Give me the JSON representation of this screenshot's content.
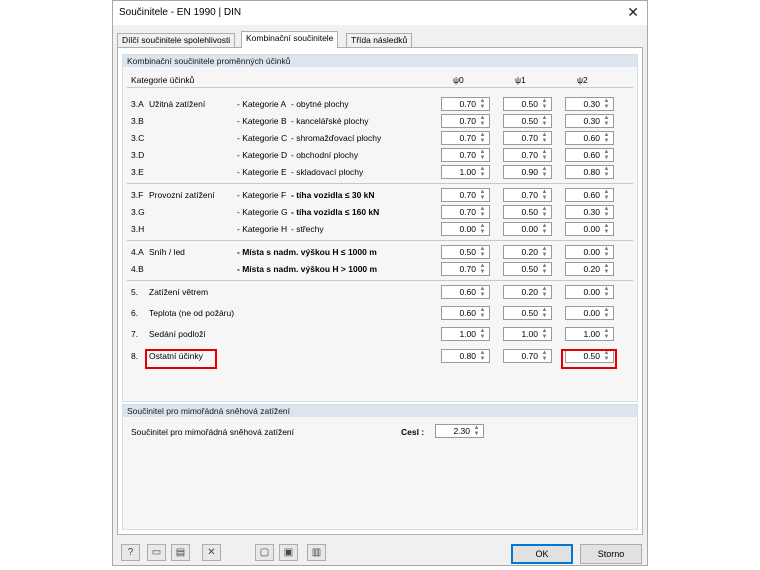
{
  "window": {
    "title": "Součinitele - EN 1990 | DIN",
    "close": "✕"
  },
  "tabs": [
    "Dílčí součinitele spolehlivosti",
    "Kombinační součinitele",
    "Třída následků"
  ],
  "group1": {
    "title": "Kombinační součinitele proměnných účinků",
    "category_header": "Kategorie účinků",
    "col_psi0": "ψ0",
    "col_psi1": "ψ1",
    "col_psi2": "ψ2",
    "rows": [
      {
        "num": "3.A",
        "name": "Užitná zatížení",
        "cat": "- Kategorie A",
        "desc": "- obytné plochy",
        "bold": false,
        "v0": "0.70",
        "v1": "0.50",
        "v2": "0.30"
      },
      {
        "num": "3.B",
        "name": "",
        "cat": "- Kategorie B",
        "desc": "- kancelářské plochy",
        "bold": false,
        "v0": "0.70",
        "v1": "0.50",
        "v2": "0.30"
      },
      {
        "num": "3.C",
        "name": "",
        "cat": "- Kategorie C",
        "desc": "- shromažďovací plochy",
        "bold": false,
        "v0": "0.70",
        "v1": "0.70",
        "v2": "0.60"
      },
      {
        "num": "3.D",
        "name": "",
        "cat": "- Kategorie D",
        "desc": "- obchodní plochy",
        "bold": false,
        "v0": "0.70",
        "v1": "0.70",
        "v2": "0.60"
      },
      {
        "num": "3.E",
        "name": "",
        "cat": "- Kategorie E",
        "desc": "- skladovací plochy",
        "bold": false,
        "v0": "1.00",
        "v1": "0.90",
        "v2": "0.80"
      },
      {
        "num": "3.F",
        "name": "Provozní zatížení",
        "cat": "- Kategorie F",
        "desc": "- tíha vozidla ≤ 30 kN",
        "bold": true,
        "v0": "0.70",
        "v1": "0.70",
        "v2": "0.60"
      },
      {
        "num": "3.G",
        "name": "",
        "cat": "- Kategorie G",
        "desc": "- tíha vozidla ≤ 160 kN",
        "bold": true,
        "v0": "0.70",
        "v1": "0.50",
        "v2": "0.30"
      },
      {
        "num": "3.H",
        "name": "",
        "cat": "- Kategorie H",
        "desc": "- střechy",
        "bold": false,
        "v0": "0.00",
        "v1": "0.00",
        "v2": "0.00"
      },
      {
        "num": "4.A",
        "name": "Sníh / led",
        "cat": "",
        "desc": "- Místa s nadm. výškou H ≤ 1000 m",
        "bold": true,
        "v0": "0.50",
        "v1": "0.20",
        "v2": "0.00"
      },
      {
        "num": "4.B",
        "name": "",
        "cat": "",
        "desc": "- Místa s nadm. výškou H > 1000 m",
        "bold": true,
        "v0": "0.70",
        "v1": "0.50",
        "v2": "0.20"
      },
      {
        "num": "5.",
        "name": "Zatížení větrem",
        "cat": "",
        "desc": "",
        "bold": false,
        "v0": "0.60",
        "v1": "0.20",
        "v2": "0.00"
      },
      {
        "num": "6.",
        "name": "Teplota (ne od požáru)",
        "cat": "",
        "desc": "",
        "bold": false,
        "v0": "0.60",
        "v1": "0.50",
        "v2": "0.00"
      },
      {
        "num": "7.",
        "name": "Sedání podloží",
        "cat": "",
        "desc": "",
        "bold": false,
        "v0": "1.00",
        "v1": "1.00",
        "v2": "1.00"
      },
      {
        "num": "8.",
        "name": "Ostatní účinky",
        "cat": "",
        "desc": "",
        "bold": false,
        "v0": "0.80",
        "v1": "0.70",
        "v2": "0.50"
      }
    ]
  },
  "group2": {
    "title": "Součinitel pro mimořádná sněhová zatížení",
    "label": "Součinitel pro mimořádná sněhová zatížení",
    "symbol": "Cesl :",
    "value": "2.30"
  },
  "toolbar_icons": [
    "help-icon",
    "new-icon",
    "save-icon",
    "delete-icon",
    "open-icon",
    "disk-icon",
    "library-icon"
  ],
  "buttons": {
    "ok": "OK",
    "cancel": "Storno"
  },
  "colors": {
    "highlight": "#e00000",
    "group_header": "#dce4ee"
  }
}
